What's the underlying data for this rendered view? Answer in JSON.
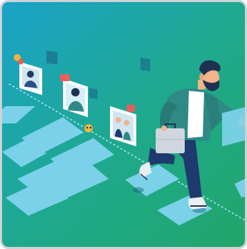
{
  "illustration": {
    "background_gradient": [
      "#1aa3c9",
      "#1fa98a",
      "#22a56a"
    ],
    "tile_color": "#7fd4ee",
    "frame_border": "#cfd3d6",
    "figure": {
      "hair": "#1f3152",
      "jacket": "#2f8a86",
      "pants": "#1f3a6e",
      "shirt": "#ffffff",
      "skin": "#f2b48a",
      "bag": "#cfd6de"
    }
  }
}
